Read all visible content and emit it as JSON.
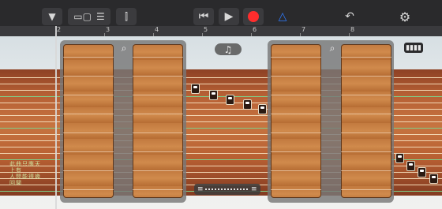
{
  "toolbar": {
    "dropdown_icon": "triangle-down-icon",
    "tracks_view_icon": "tracks-view-icon",
    "list_icon": "list-view-icon",
    "mixer_icon": "mixer-icon",
    "rewind_icon": "rewind-icon",
    "play_icon": "play-icon",
    "record_icon": "record-icon",
    "metronome_icon": "metronome-icon",
    "undo_icon": "undo-icon",
    "settings_icon": "gear-icon",
    "record_color": "#ff2d2d",
    "metronome_color": "#2f7bff"
  },
  "ruler": {
    "bars": [
      "2",
      "3",
      "4",
      "5",
      "6",
      "7",
      "8"
    ]
  },
  "instrument": {
    "note_button_label": "♫",
    "view_button_label": "▮▮▮▮",
    "calligraphy_lines": [
      "此曲只應天上有",
      "人間能得幾回聞"
    ]
  },
  "colors": {
    "wood_string": "#f3d8b5",
    "green_string": "#7fd08a"
  }
}
